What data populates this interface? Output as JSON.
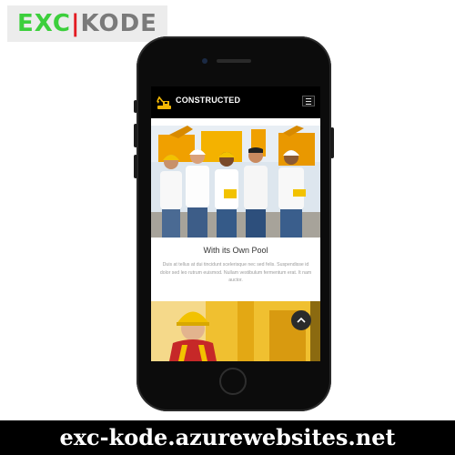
{
  "watermark": {
    "exc": "EXC",
    "bar": "|",
    "kode": "KODE"
  },
  "app": {
    "brand_name": "CONSTRUCTED"
  },
  "card": {
    "title": "With its Own Pool",
    "body": "Duis at tellus at dui tincidunt scelerisque nec sed felis. Suspendisse id dolor sed leo rutrum euismod. Nullam vestibulum fermentum erat. It nam auctor."
  },
  "footer": {
    "url": "exc-kode.azurewebsites.net"
  },
  "icons": {
    "logo": "excavator-icon",
    "menu": "hamburger-menu-icon",
    "scroll_top": "chevron-up-icon"
  },
  "colors": {
    "accent": "#f2b705",
    "watermark_green": "#3ccf3c",
    "watermark_red": "#e31b23"
  }
}
